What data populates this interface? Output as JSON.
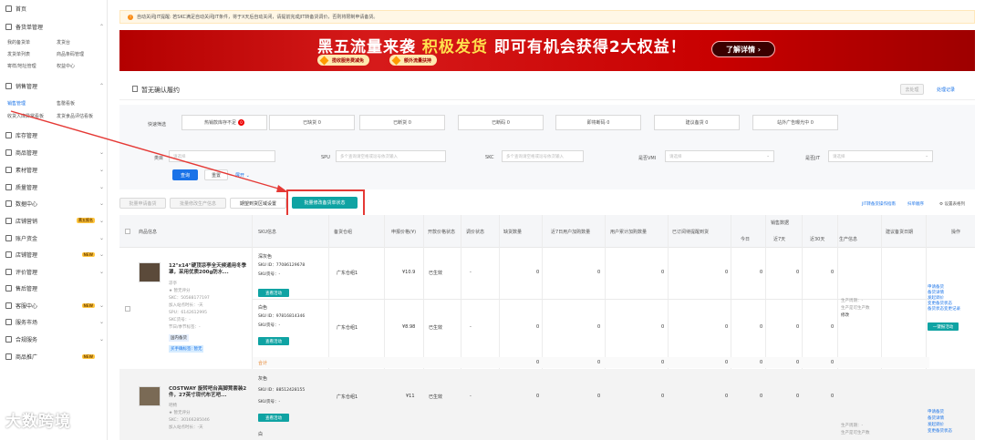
{
  "sidebar": {
    "home": "首页",
    "sections": [
      {
        "label": "备货单管理",
        "subs": [
          "我的备货单",
          "发货台",
          "发货单列表",
          "商品条码管理",
          "寄样/地址管理",
          "权益中心"
        ]
      },
      {
        "label": "销售管理",
        "subs": [
          "销售管理",
          "售罄看板",
          "收货入库异常看板",
          "发货食品评估看板"
        ]
      }
    ],
    "items": [
      {
        "label": "库存管理"
      },
      {
        "label": "商品管理"
      },
      {
        "label": "素材管理"
      },
      {
        "label": "质量管理"
      },
      {
        "label": "数据中心"
      },
      {
        "label": "店铺营销",
        "tag": "黑五报名"
      },
      {
        "label": "账户资金"
      },
      {
        "label": "店铺管理",
        "tag": "NEW"
      },
      {
        "label": "评价管理"
      },
      {
        "label": "售后管理"
      },
      {
        "label": "客服中心",
        "tag": "NEW"
      },
      {
        "label": "服务市场"
      },
      {
        "label": "合规服务"
      },
      {
        "label": "商品推广",
        "tag": "NEW"
      }
    ]
  },
  "notice": "自动关闭JIT提醒: 若SKC满足自动关闭JIT条件，将于X天后自动关闭，请提前完成JIT转备货调价，否则将限制申请备货。",
  "banner": {
    "slogan_white": "黑五流量来袭",
    "slogan_yellow": "积极发货",
    "slogan_rest": "即可有机会获得2大权益！",
    "pill1": "揽收服务费减免",
    "pill2": "额外流量扶持",
    "more": "了解详情 ›"
  },
  "panel": {
    "title": "暂无确认履约",
    "btn_process": "去处理",
    "link_records": "处理记录"
  },
  "quick_filter": {
    "label": "快速筛选",
    "items": [
      {
        "label": "热销款库存不足",
        "badge": "0"
      },
      {
        "label": "已缺货 0"
      },
      {
        "label": "已断货 0"
      },
      {
        "label": "已断码 0"
      },
      {
        "label": "即将断码 0"
      },
      {
        "label": "建议备货 0"
      },
      {
        "label": "站外广告曝光中 0"
      }
    ]
  },
  "filters": {
    "category_label": "类目",
    "category_ph": "请选择",
    "spu_label": "SPU",
    "spu_ph": "多个查询请空格或逗号依次输入",
    "skc_label": "SKC",
    "skc_ph": "多个查询请空格或逗号依次输入",
    "vmi_label": "是否VMI",
    "vmi_ph": "请选择",
    "jit_label": "是否JIT",
    "jit_ph": "请选择",
    "query": "查询",
    "reset": "重置",
    "expand": "展开 ⌄"
  },
  "actions": {
    "batch_apply": "批量申请备货",
    "batch_modify_prod": "批量修改生产信息",
    "expect_region": "期望到货区域设置",
    "batch_modify_state": "批量修改备货单状态",
    "link_guide": "JIT转备货操作指南",
    "link_sort": "扫单顺序",
    "link_cols": "设置表格列"
  },
  "table": {
    "headers": [
      "商品信息",
      "SKU信息",
      "备货仓组",
      "申报价格(¥)",
      "开款价格状态",
      "调价状态",
      "缺货数量",
      "近7日用户加购数量",
      "用户累计加购数量",
      "已订阅待提醒到货",
      "销售数据",
      "今日",
      "近7天",
      "近30天",
      "生产信息",
      "建议备货日期",
      "操作"
    ],
    "products": [
      {
        "title": "12\"x14\"硬顶凉亭全天候通用冬季罩，采用优质200g防水...",
        "lines": [
          "凉亭",
          "★ 暂无评分",
          "SKC：50588177197",
          "加入站点时长：-天",
          "SPU：6142612995",
          "SKC货号：-",
          "节日/季节标签：-"
        ],
        "tag1": "国内备货",
        "tag2": "买手确标签: 暂无",
        "skus": [
          {
            "color": "深灰色",
            "id": "SKU ID：77086129678",
            "code": "SKU货号：-",
            "btn": "查看活动",
            "warehouse": "广东仓组1",
            "price": "¥10.9",
            "state": "已生效",
            "dash": "-",
            "nums": [
              "0",
              "0",
              "0",
              "0",
              "0",
              "0",
              "0"
            ]
          },
          {
            "color": "白色",
            "id": "SKU ID：97816814346",
            "code": "SKU货号：-",
            "btn": "查看活动",
            "warehouse": "广东仓组1",
            "price": "¥8.98",
            "state": "已生效",
            "dash": "-",
            "nums": [
              "0",
              "0",
              "0",
              "0",
              "0",
              "0",
              "0"
            ]
          }
        ],
        "total": "合计",
        "total_nums": [
          "0",
          "0",
          "0",
          "0",
          "0",
          "0",
          "0"
        ],
        "prod_info": [
          "生产周期：-",
          "生产是可生产数",
          "修改"
        ],
        "ops": [
          "申请备货",
          "备货详情",
          "发起调价",
          "变更备货状态",
          "备货状态变更记录"
        ],
        "ops_btn": "一键报活动"
      },
      {
        "title": "COSTWAY 旋转吧台高脚凳套装2件，27英寸现代布艺吧...",
        "lines": [
          "吧椅",
          "★ 暂无评分",
          "SKC：30166285046",
          "加入站点时长：-天"
        ],
        "skus": [
          {
            "color": "灰色",
            "id": "SKU ID：88512428155",
            "code": "SKU货号：-",
            "btn": "查看活动",
            "warehouse": "广东仓组1",
            "price": "¥11",
            "state": "已生效",
            "dash": "-",
            "nums": [
              "0",
              "0",
              "0",
              "0",
              "0",
              "0",
              "0"
            ]
          },
          {
            "color": "白"
          }
        ],
        "prod_info": [
          "生产周期：-",
          "生产是可生产数"
        ],
        "ops": [
          "申请备货",
          "备货详情",
          "发起调价",
          "变更备货状态"
        ]
      }
    ]
  },
  "watermark": "大数跨境",
  "colors": {
    "primary": "#1a73e8",
    "teal": "#0fa3a3",
    "annotation": "#e53935",
    "banner": "#c80000"
  }
}
